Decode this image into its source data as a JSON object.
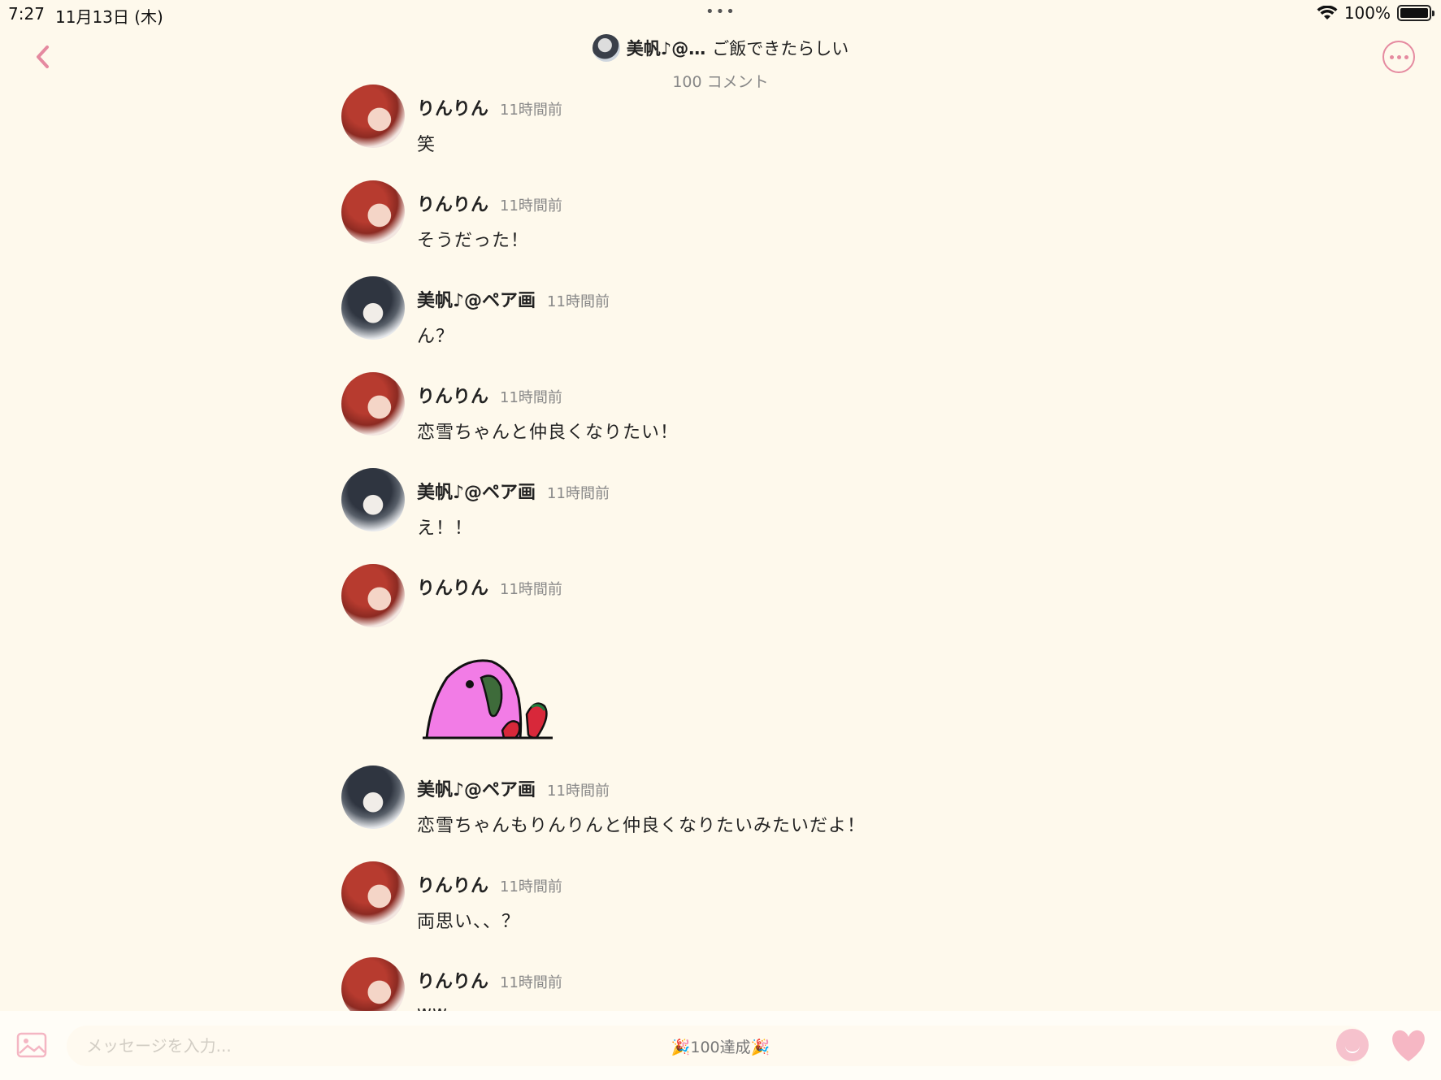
{
  "status_bar": {
    "time": "7:27",
    "date": "11月13日 (木)",
    "dots": "•••",
    "battery_text": "100%"
  },
  "header": {
    "user": "美帆♪@…",
    "thread_title": "ご飯できたらしい",
    "subtitle": "100 コメント"
  },
  "messages": [
    {
      "user": "りんりん",
      "time": "11時間前",
      "text": "笑",
      "avatar": "rin"
    },
    {
      "user": "りんりん",
      "time": "11時間前",
      "text": "そうだった！",
      "avatar": "rin"
    },
    {
      "user": "美帆♪@ペア画",
      "time": "11時間前",
      "text": "ん？",
      "avatar": "miho"
    },
    {
      "user": "りんりん",
      "time": "11時間前",
      "text": "恋雪ちゃんと仲良くなりたい！",
      "avatar": "rin"
    },
    {
      "user": "美帆♪@ペア画",
      "time": "11時間前",
      "text": "え！！",
      "avatar": "miho"
    },
    {
      "user": "りんりん",
      "time": "11時間前",
      "text": "",
      "avatar": "rin"
    },
    {
      "user": "美帆♪@ペア画",
      "time": "11時間前",
      "text": "恋雪ちゃんもりんりんと仲良くなりたいみたいだよ！",
      "avatar": "miho"
    },
    {
      "user": "りんりん",
      "time": "11時間前",
      "text": "両思い、、？",
      "avatar": "rin"
    },
    {
      "user": "りんりん",
      "time": "11時間前",
      "text": "ww",
      "avatar": "rin"
    }
  ],
  "composer": {
    "placeholder": "メッセージを入力...",
    "milestone": "🎉100達成🎉"
  },
  "colors": {
    "background": "#fef9ec",
    "accent": "#e58aa0"
  },
  "icons": {
    "back": "chevron-left-icon",
    "more": "ellipsis-circle-icon",
    "image": "image-icon",
    "emoji": "smiley-icon",
    "like": "heart-icon"
  }
}
